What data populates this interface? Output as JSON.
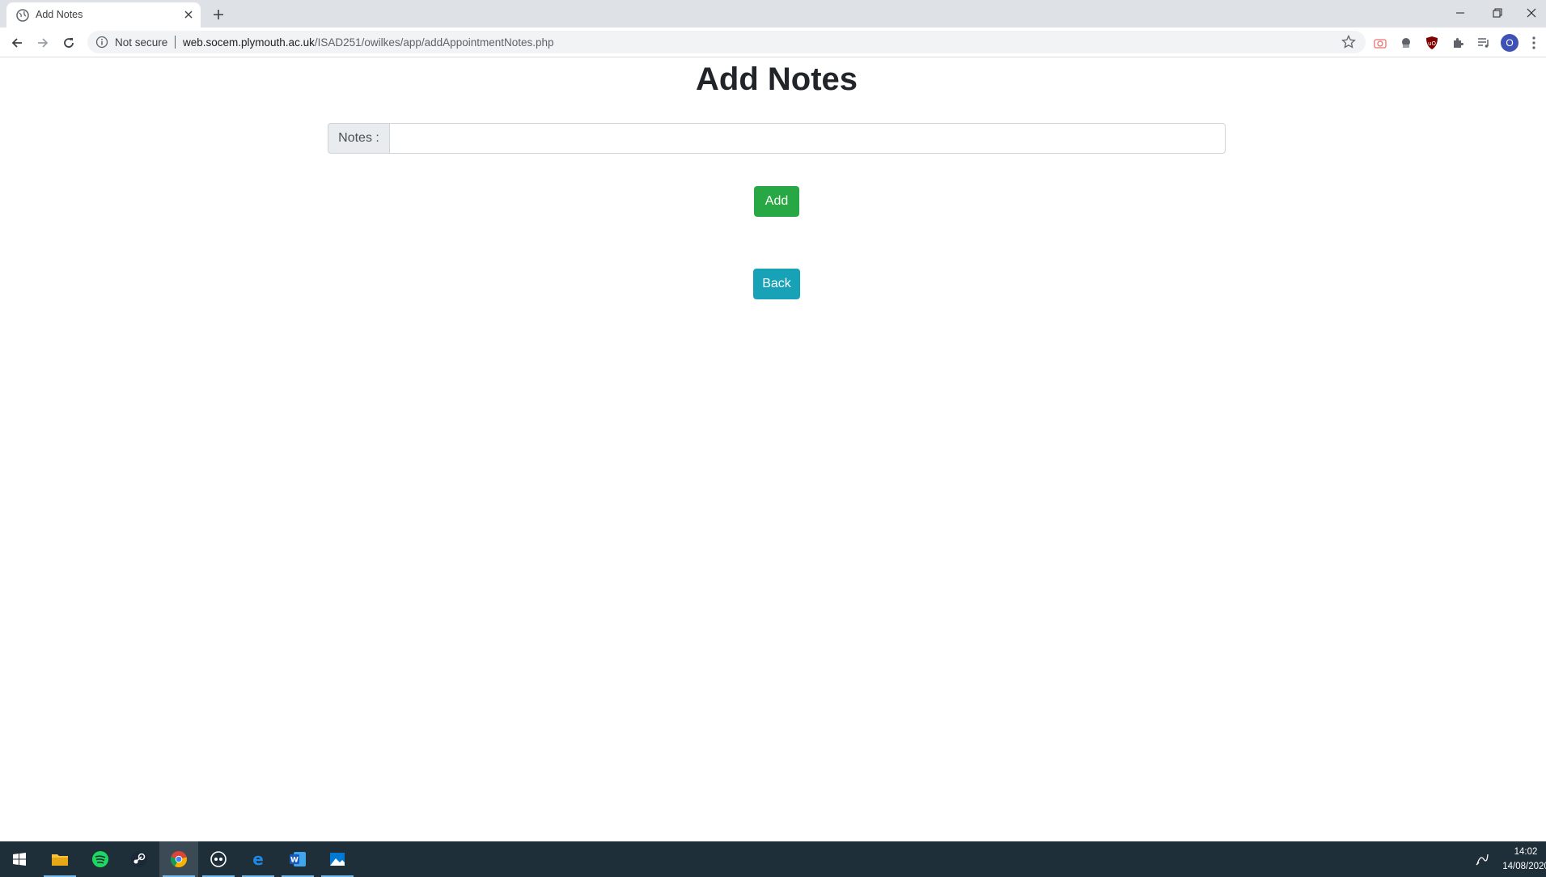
{
  "browser": {
    "tab_title": "Add Notes",
    "security_label": "Not secure",
    "url_host": "web.socem.plymouth.ac.uk",
    "url_path": "/ISAD251/owilkes/app/addAppointmentNotes.php",
    "profile_initial": "O"
  },
  "page": {
    "title": "Add Notes",
    "notes_label": "Notes :",
    "notes_value": "",
    "add_label": "Add",
    "back_label": "Back",
    "colors": {
      "add_button": "#28a745",
      "back_button": "#17a2b8"
    }
  },
  "taskbar": {
    "time": "14:02",
    "date": "14/08/2020",
    "apps": [
      "start-icon",
      "file-explorer-icon",
      "spotify-icon",
      "steam-icon",
      "chrome-icon",
      "app-icon",
      "edge-icon",
      "word-icon",
      "photos-icon"
    ]
  }
}
